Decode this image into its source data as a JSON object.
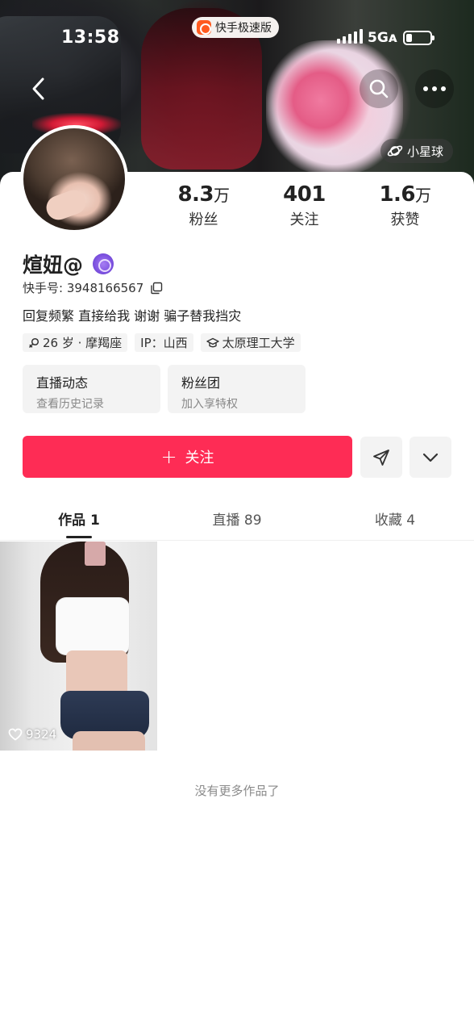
{
  "status_bar": {
    "time": "13:58",
    "app_name": "快手极速版",
    "network": "5Gᴀ"
  },
  "cover": {
    "planet_label": "小星球"
  },
  "profile": {
    "stats": [
      {
        "value": "8.3",
        "unit": "万",
        "label": "粉丝"
      },
      {
        "value": "401",
        "unit": "",
        "label": "关注"
      },
      {
        "value": "1.6",
        "unit": "万",
        "label": "获赞"
      }
    ],
    "username": "煊妞@",
    "kuaishou_id_label": "快手号: 3948166567",
    "bio": "回复频繁 直接给我 谢谢 骗子替我挡灾",
    "tags": [
      {
        "text": "26 岁 · 摩羯座",
        "icon": "gender-icon"
      },
      {
        "text": "IP：山西",
        "icon": ""
      },
      {
        "text": "太原理工大学",
        "icon": "graduation-cap-icon"
      }
    ],
    "cards": [
      {
        "title": "直播动态",
        "subtitle": "查看历史记录"
      },
      {
        "title": "粉丝团",
        "subtitle": "加入享特权"
      }
    ]
  },
  "actions": {
    "follow_label": "关注",
    "accent_color": "#fe2c55"
  },
  "tabs": [
    {
      "label": "作品 1",
      "active": true
    },
    {
      "label": "直播 89",
      "active": false
    },
    {
      "label": "收藏 4",
      "active": false
    }
  ],
  "works": [
    {
      "likes": "9324"
    }
  ],
  "footer": {
    "no_more_text": "没有更多作品了"
  }
}
